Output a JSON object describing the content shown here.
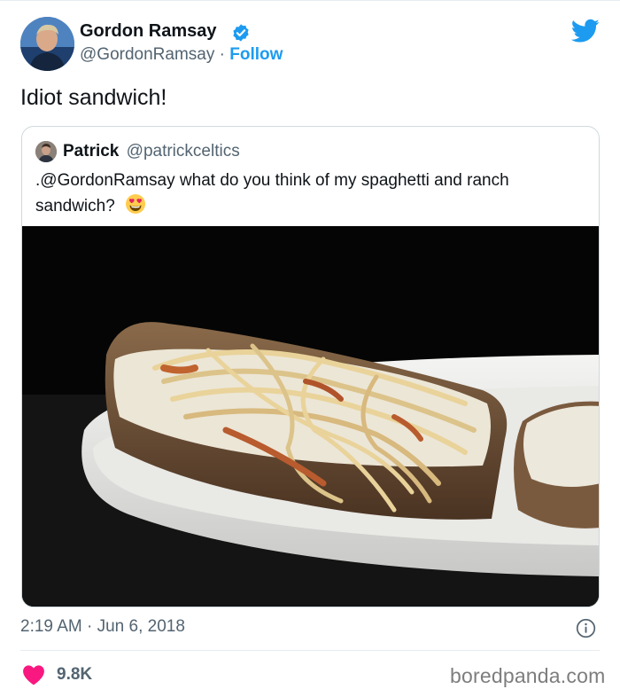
{
  "tweet": {
    "author": {
      "name": "Gordon Ramsay",
      "handle": "@GordonRamsay",
      "separator": " · ",
      "follow_label": "Follow",
      "verified": true
    },
    "text": "Idiot sandwich!",
    "timestamp": "2:19 AM · Jun 6, 2018",
    "likes": "9.8K"
  },
  "quoted_tweet": {
    "author": {
      "name": "Patrick",
      "handle": "@patrickceltics"
    },
    "text": ".@GordonRamsay what do you think of my spaghetti and ranch sandwich?",
    "emoji": "heart-eyes-emoji",
    "image": "spaghetti-and-ranch-sandwich-photo"
  },
  "watermark": "boredpanda.com",
  "colors": {
    "accent": "#1d9bf0",
    "text": "#0f1419",
    "muted": "#536471",
    "like": "#f91880",
    "border": "#cfd9de"
  },
  "icons": [
    "verified-badge-icon",
    "twitter-bird-icon",
    "info-icon",
    "heart-icon"
  ]
}
